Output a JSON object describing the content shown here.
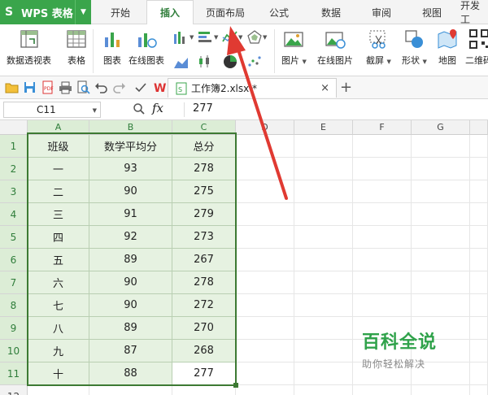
{
  "app": {
    "title": "WPS 表格",
    "logo": "S"
  },
  "tabs": [
    "开始",
    "插入",
    "页面布局",
    "公式",
    "数据",
    "审阅",
    "视图",
    "开发工"
  ],
  "active_tab": "插入",
  "ribbon": {
    "pivot_table": "数据透视表",
    "table": "表格",
    "chart": "图表",
    "online_chart": "在线图表",
    "picture": "图片",
    "online_picture": "在线图片",
    "screenshot": "截屏",
    "shapes": "形状",
    "map": "地图",
    "qrcode": "二维码"
  },
  "file_tab": {
    "name": "工作簿2.xlsx *",
    "close": "×",
    "new": "+"
  },
  "formula_bar": {
    "cell_ref": "C11",
    "fx": "fx",
    "value": "277"
  },
  "grid": {
    "columns": [
      "A",
      "B",
      "C",
      "D",
      "E",
      "F",
      "G"
    ],
    "rows": [
      "1",
      "2",
      "3",
      "4",
      "5",
      "6",
      "7",
      "8",
      "9",
      "10",
      "11",
      "12"
    ],
    "header": [
      "班级",
      "数学平均分",
      "总分"
    ],
    "data": [
      [
        "一",
        "93",
        "278"
      ],
      [
        "二",
        "90",
        "275"
      ],
      [
        "三",
        "91",
        "279"
      ],
      [
        "四",
        "92",
        "273"
      ],
      [
        "五",
        "89",
        "267"
      ],
      [
        "六",
        "90",
        "278"
      ],
      [
        "七",
        "90",
        "272"
      ],
      [
        "八",
        "89",
        "270"
      ],
      [
        "九",
        "87",
        "268"
      ],
      [
        "十",
        "88",
        "277"
      ]
    ]
  },
  "watermark": {
    "title": "百科全说",
    "subtitle": "助你轻松解决"
  },
  "colors": {
    "brand_green": "#3aa54b",
    "selection_green": "#3d7a33",
    "cell_shade": "#e6f2e1",
    "arrow_red": "#e03a32"
  }
}
